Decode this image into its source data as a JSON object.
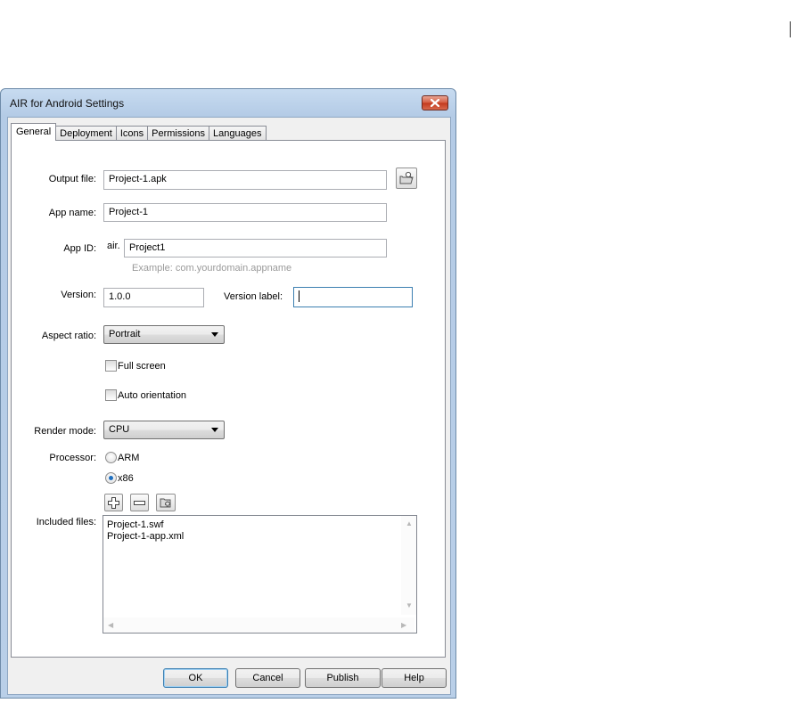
{
  "window": {
    "title": "AIR for Android Settings"
  },
  "tabs": [
    {
      "label": "General",
      "active": true
    },
    {
      "label": "Deployment",
      "active": false
    },
    {
      "label": "Icons",
      "active": false
    },
    {
      "label": "Permissions",
      "active": false
    },
    {
      "label": "Languages",
      "active": false
    }
  ],
  "general": {
    "output_file": {
      "label": "Output file:",
      "value": "Project-1.apk"
    },
    "app_name": {
      "label": "App name:",
      "value": "Project-1"
    },
    "app_id": {
      "label": "App ID:",
      "prefix": "air.",
      "value": "Project1",
      "hint": "Example: com.yourdomain.appname"
    },
    "version": {
      "label": "Version:",
      "value": "1.0.0"
    },
    "version_label": {
      "label": "Version label:",
      "value": ""
    },
    "aspect_ratio": {
      "label": "Aspect ratio:",
      "value": "Portrait"
    },
    "full_screen": {
      "label": "Full screen",
      "checked": false
    },
    "auto_orientation": {
      "label": "Auto orientation",
      "checked": false
    },
    "render_mode": {
      "label": "Render mode:",
      "value": "CPU"
    },
    "processor": {
      "label": "Processor:",
      "options": [
        {
          "label": "ARM",
          "selected": false
        },
        {
          "label": "x86",
          "selected": true
        }
      ]
    },
    "included_files": {
      "label": "Included files:",
      "items": [
        "Project-1.swf",
        "Project-1-app.xml"
      ]
    }
  },
  "buttons": {
    "ok": "OK",
    "cancel": "Cancel",
    "publish": "Publish",
    "help": "Help"
  },
  "icons": {
    "browse": "folder-browse-icon",
    "add": "plus-icon",
    "remove": "minus-icon",
    "add_folder": "add-folder-icon",
    "close": "close-icon"
  },
  "colors": {
    "selected_radio": "#1f6fbf",
    "close_button": "#c2391c",
    "title_bar": "#b9cfe8"
  }
}
